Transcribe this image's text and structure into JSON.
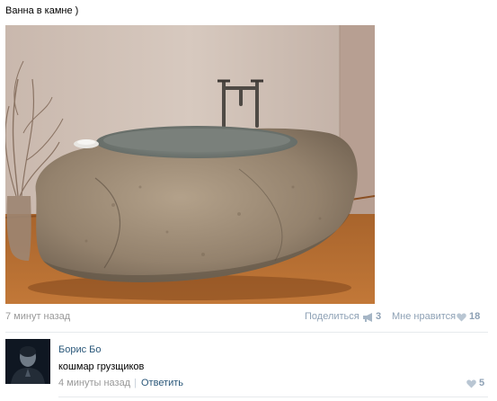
{
  "post": {
    "title": "Ванна в камне )",
    "image_alt": "stone bathtub photo",
    "timestamp": "7 минут назад",
    "share_label": "Поделиться",
    "share_count": "3",
    "like_label": "Мне нравится",
    "like_count": "18"
  },
  "comment": {
    "author": "Борис Бо",
    "text": "кошмар грузщиков",
    "time": "4 минуты назад",
    "separator": "|",
    "reply_label": "Ответить",
    "like_count": "5"
  },
  "icons": {
    "share": "megaphone-icon",
    "like": "heart-icon"
  },
  "colors": {
    "link": "#2b587a",
    "muted": "#999999",
    "action": "#8ea1b5"
  }
}
